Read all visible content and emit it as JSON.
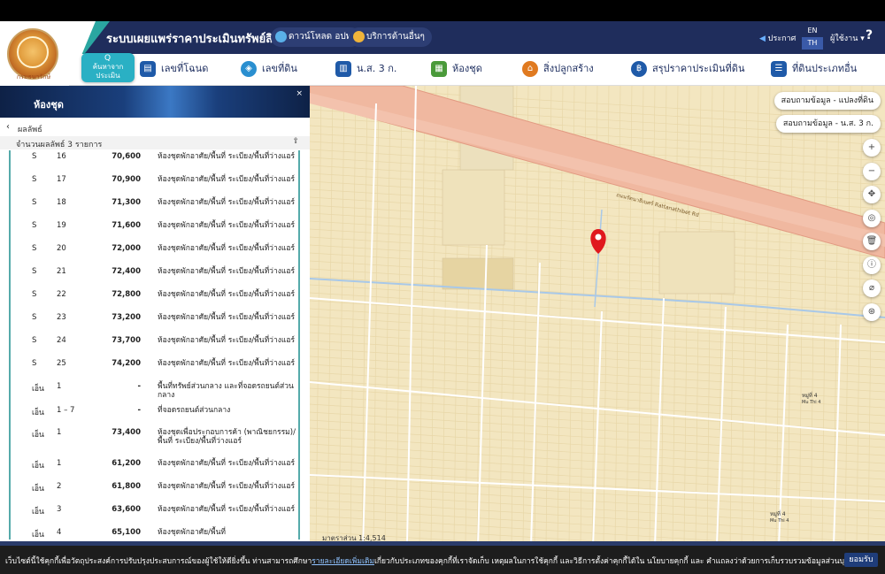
{
  "header": {
    "app_title": "ระบบเผยแพร่ราคาประเมินทรัพย์สิน",
    "logo_caption": "กรมธนารักษ์",
    "download_btn": "ดาวน์โหลด อปท.",
    "service_btn": "บริการด้านอื่นๆ",
    "announce": "ประกาศ",
    "lang_en": "EN",
    "lang_th": "TH",
    "user": "ผู้ใช้งาน",
    "help": "?"
  },
  "nav": {
    "active_icon": "Q",
    "active_label_1": "ค้นหาจาก",
    "active_label_2": "ประเมิน",
    "items": [
      {
        "label": "เลขที่โฉนด",
        "color": "#1f5aa8"
      },
      {
        "label": "เลขที่ดิน",
        "color": "#2a8fd0"
      },
      {
        "label": "น.ส. 3 ก.",
        "color": "#1f5aa8"
      },
      {
        "label": "ห้องชุด",
        "color": "#4a9a3a"
      },
      {
        "label": "สิ่งปลูกสร้าง",
        "color": "#e07a20"
      },
      {
        "label": "สรุปราคาประเมินที่ดิน",
        "color": "#1f5aa8"
      },
      {
        "label": "ที่ดินประเภทอื่น",
        "color": "#1f5aa8"
      }
    ]
  },
  "panel": {
    "title": "ห้องชุด",
    "close": "×",
    "result_label": "ผลลัพธ์",
    "count_label": "จำนวนผลลัพธ์ 3 รายการ",
    "rows": [
      {
        "a": "S",
        "b": "16",
        "price": "70,600",
        "desc": "ห้องชุดพักอาศัย/พื้นที่ ระเบียง/พื้นที่ว่างแอร์"
      },
      {
        "a": "S",
        "b": "17",
        "price": "70,900",
        "desc": "ห้องชุดพักอาศัย/พื้นที่ ระเบียง/พื้นที่ว่างแอร์"
      },
      {
        "a": "S",
        "b": "18",
        "price": "71,300",
        "desc": "ห้องชุดพักอาศัย/พื้นที่ ระเบียง/พื้นที่ว่างแอร์"
      },
      {
        "a": "S",
        "b": "19",
        "price": "71,600",
        "desc": "ห้องชุดพักอาศัย/พื้นที่ ระเบียง/พื้นที่ว่างแอร์"
      },
      {
        "a": "S",
        "b": "20",
        "price": "72,000",
        "desc": "ห้องชุดพักอาศัย/พื้นที่ ระเบียง/พื้นที่ว่างแอร์"
      },
      {
        "a": "S",
        "b": "21",
        "price": "72,400",
        "desc": "ห้องชุดพักอาศัย/พื้นที่ ระเบียง/พื้นที่ว่างแอร์"
      },
      {
        "a": "S",
        "b": "22",
        "price": "72,800",
        "desc": "ห้องชุดพักอาศัย/พื้นที่ ระเบียง/พื้นที่ว่างแอร์"
      },
      {
        "a": "S",
        "b": "23",
        "price": "73,200",
        "desc": "ห้องชุดพักอาศัย/พื้นที่ ระเบียง/พื้นที่ว่างแอร์"
      },
      {
        "a": "S",
        "b": "24",
        "price": "73,700",
        "desc": "ห้องชุดพักอาศัย/พื้นที่ ระเบียง/พื้นที่ว่างแอร์"
      },
      {
        "a": "S",
        "b": "25",
        "price": "74,200",
        "desc": "ห้องชุดพักอาศัย/พื้นที่ ระเบียง/พื้นที่ว่างแอร์"
      },
      {
        "a": "เอ็น",
        "b": "1",
        "price": "-",
        "desc": "พื้นที่ทรัพย์ส่วนกลาง และที่จอดรถยนต์ส่วนกลาง"
      },
      {
        "a": "เอ็น",
        "b": "1 – 7",
        "price": "-",
        "desc": "ที่จอดรถยนต์ส่วนกลาง"
      },
      {
        "a": "เอ็น",
        "b": "1",
        "price": "73,400",
        "desc": "ห้องชุดเพื่อประกอบการค้า (พาณิชยกรรม)/พื้นที่ ระเบียง/พื้นที่ว่างแอร์"
      },
      {
        "a": "เอ็น",
        "b": "1",
        "price": "61,200",
        "desc": "ห้องชุดพักอาศัย/พื้นที่ ระเบียง/พื้นที่ว่างแอร์"
      },
      {
        "a": "เอ็น",
        "b": "2",
        "price": "61,800",
        "desc": "ห้องชุดพักอาศัย/พื้นที่ ระเบียง/พื้นที่ว่างแอร์"
      },
      {
        "a": "เอ็น",
        "b": "3",
        "price": "63,600",
        "desc": "ห้องชุดพักอาศัย/พื้นที่ ระเบียง/พื้นที่ว่างแอร์"
      },
      {
        "a": "เอ็น",
        "b": "4",
        "price": "65,100",
        "desc": "ห้องชุดพักอาศัย/พื้นที่"
      }
    ]
  },
  "map": {
    "btn_parcel": "สอบถามข้อมูล - แปลงที่ดิน",
    "btn_ns3": "สอบถามข้อมูล - น.ส. 3 ก.",
    "scale": "มาตราส่วน 1:4,514",
    "road_label": "ถนนรัตนาธิเบศร์ Rattanathibet Rd",
    "moo_label": "หมู่ที่ 4",
    "moo_en": "Mu Thi 4",
    "tools": [
      "+",
      "−",
      "✥",
      "◎",
      "🗑",
      "ⓘ",
      "⌀",
      "⊛"
    ]
  },
  "cookie": {
    "text_before": "เว็บไซต์นี้ใช้คุกกี้เพื่อวัตถุประสงค์การปรับปรุงประสบการณ์ของผู้ใช้ให้ดียิ่งขึ้น ท่านสามารถศึกษา",
    "link": "รายละเอียดเพิ่มเติม",
    "text_after": "เกี่ยวกับประเภทของคุกกี้ที่เราจัดเก็บ เหตุผลในการใช้คุกกี้ และวิธีการตั้งค่าคุกกี้ได้ใน นโยบายคุกกี้ และ คำแถลงว่าด้วยการเก็บรวบรวมข้อมูลส่วนบุคคล",
    "accept": "ยอมรับ"
  }
}
